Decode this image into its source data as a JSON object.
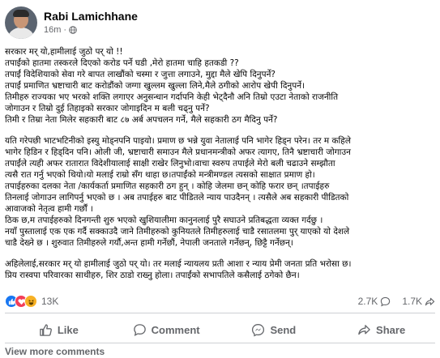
{
  "post": {
    "author": "Rabi Lamichhane",
    "timestamp": "16m",
    "separator": "·",
    "audience_icon": "globe-icon",
    "lines": [
      "सरकार मर् यो,हामीलाई जुठो पर् यो !!",
      "तपाईंको  हातमा तस्करले दिएको करोड पर्ने घडी ,मेरो हातमा चाहि हतकडी ??",
      "तपाईं  विदेशियाको सेवा गरे बापत लाखौंको चस्मा र जुत्ता लगाउने, मुद्दा मैले खेपि दिनुपर्ने?",
      "तपाईं  प्रमाणित भ्रष्टाचारी बाट करोडौंको जग्गा खुल्लम खुल्ला लिने,मैले  ठगीको आरोप खेपी दिनुपर्ने।",
      "तिमीहरु राज्यका भए भरको शक्ति लगाएर अनुसन्धान गर्दापनि केही भेट्दैनौ अनि तिम्रो  एउटा नेताको राजनीति",
      "जोगाउन र तिम्रो दुई तिहाइको सरकार जोगाइदिन म बली चढ्नु पर्ने?",
      "तिमी र तिम्रा नेता मिलेर सहकारी बाट ८७ अर्ब अपचलन गर्ने, मैले सहकारी ठग मैदिनु पर्ने?",
      "GAP",
      "यति गरेपछी भाटभटिनीको इस्यु मोड्नपनि पाइयो। प्रमाण छ भन्ने युवा नेतालाई पनि भागेर हिड्न परेन। तर म कहिले",
      "भागेर हिडिन र हिड्दिन पनि। ओली जी, भ्रष्टाचारी समाउन मैले प्रधानमन्त्रीको अफर त्यागए, तिनै  भ्रष्टाचारी जोगाउन",
      "तपाईंले  त्यही अफर रातारात विदेशीयालाई साक्षी राखेर लिनुभो।वाचा स्वरुप तपाईले मेरो बली चढाउने सम्झौता",
      "त्यसै रात गर्नु भएको थियो।यो मलाई राम्रो सँग थाहा छ।तपाईंको मन्त्रीमण्डल त्यसको साक्षात प्रमाण हो।",
      "तपाईहरुका   दलका   नेता /कार्यकर्ता प्रमाणित सहकारी ठग हुन् । कोहि जेलमा छन् कोहि फरार छन् ।तपाईहरु",
      "तिनलाई जोगाउन लागिपर्नु भएको छ । अब तपाईहरु बाट पीडितले न्याय पाउदैनन् । त्यसैले अब सहकारी पीडितको",
      "आवाजको नेतृत्व हामी गर्छौं ।",
      "ठिक छ,म तपाईहरुको  दिनगन्ती शुरु भएको खुशियालीमा कानुनलाई पुरै सघाउने प्रतिबद्धता व्यक्त गर्दछु ।",
      "नयाँ पुस्तालाई एक एक गर्दै सक्काउदै जाने तिमीहरुको कुनियतले तिमीहरुलाई चाडै रसातलमा पुर् याएको यो देशले",
      "चाडै देख्ने छ । शुरुवात तिमीहरुले गर्यौ,अन्त हामी गर्नेछौं, नेपाली जनताले गर्नेछन्,  छिट्टै गर्नेछन्।",
      "GAP",
      "अहिलेलाई,सरकार मर् यो हामीलाई जुठो पर् यो। तर  मलाई  न्यायलय प्रती आशा र न्याय प्रेमी जनता प्रति भरोसा छ।",
      "प्रिय रास्वपा परिवारका साथीहरु, शिर ठाडो राख्नु होला। तपाईंको सभापतिले कसैलाई ठगेको छैन।"
    ]
  },
  "reactions": {
    "icons": [
      "like-emoji",
      "love-emoji",
      "haha-emoji"
    ],
    "count": "13K",
    "comments": "2.7K",
    "shares": "1.7K"
  },
  "actions": {
    "like": "Like",
    "comment": "Comment",
    "send": "Send",
    "share": "Share"
  },
  "view_more": "View more comments",
  "colors": {
    "like": "#1877f2",
    "love": "#f33e58",
    "haha": "#f7b125",
    "secondary_text": "#65676b",
    "divider": "#ced0d4"
  }
}
